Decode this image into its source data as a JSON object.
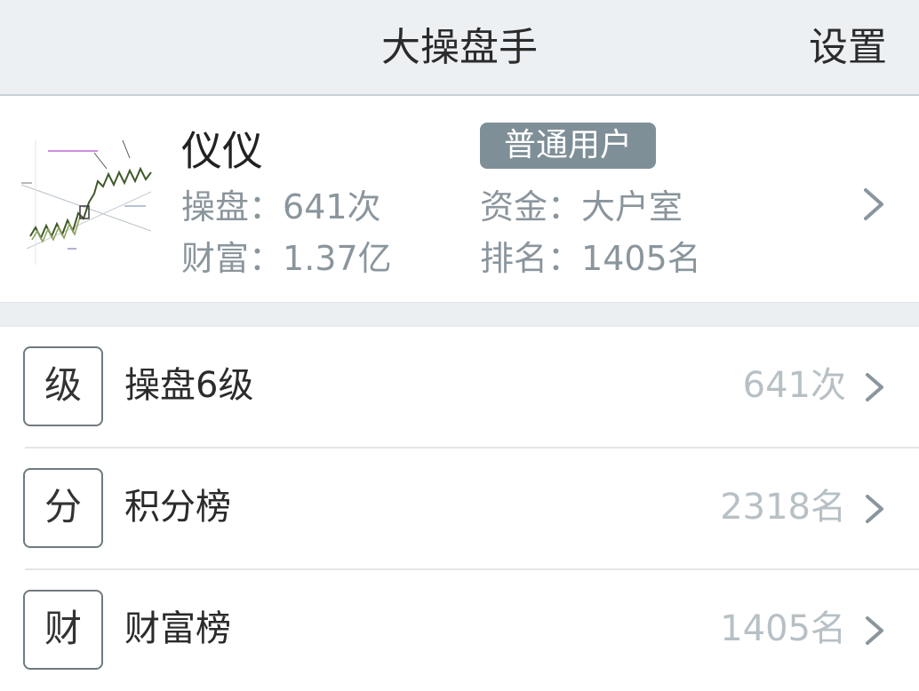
{
  "header": {
    "title": "大操盘手",
    "settings_label": "设置"
  },
  "profile": {
    "name": "仪仪",
    "badge": "普通用户",
    "stats": {
      "ops_label": "操盘",
      "ops_value": "641次",
      "wealth_label": "财富",
      "wealth_value": "1.37亿",
      "fund_label": "资金",
      "fund_value": "大户室",
      "rank_label": "排名",
      "rank_value": "1405名"
    },
    "avatar_icon": "stock-chart-thumbnail"
  },
  "list": {
    "items": [
      {
        "icon_char": "级",
        "label": "操盘6级",
        "value": "641次"
      },
      {
        "icon_char": "分",
        "label": "积分榜",
        "value": "2318名"
      },
      {
        "icon_char": "财",
        "label": "财富榜",
        "value": "1405名"
      }
    ]
  },
  "colors": {
    "header_bg": "#edf0f3",
    "badge_bg": "#7f8f97",
    "muted_text": "#8a959c",
    "value_text": "#b7c0c5",
    "chevron": "#8a959c"
  }
}
